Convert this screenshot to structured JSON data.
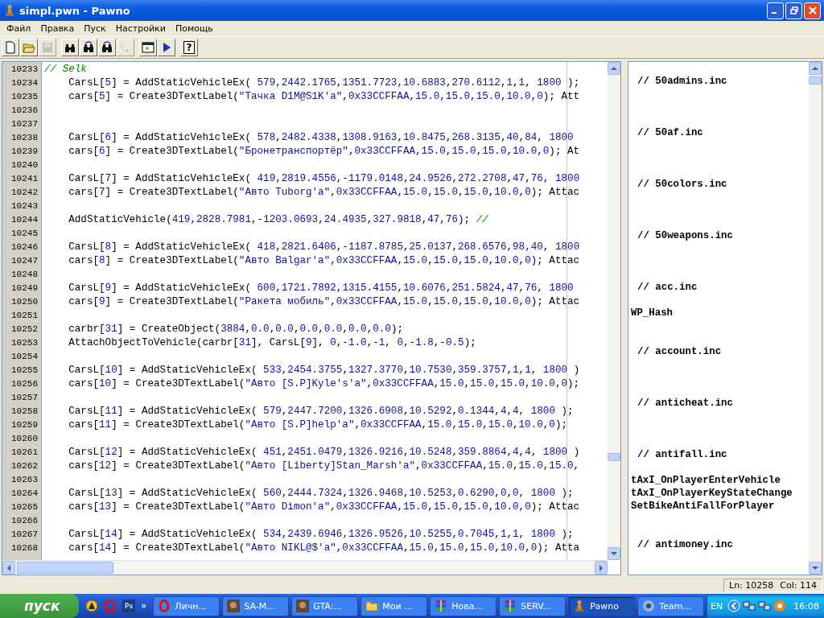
{
  "window": {
    "title": "simpl.pwn - Pawno"
  },
  "menu": [
    {
      "label": "Файл"
    },
    {
      "label": "Правка"
    },
    {
      "label": "Пуск"
    },
    {
      "label": "Настройки"
    },
    {
      "label": "Помощь"
    }
  ],
  "toolbar": {
    "groups": [
      {
        "buttons": [
          {
            "kind": "new",
            "disabled": false
          },
          {
            "kind": "open",
            "disabled": false
          },
          {
            "kind": "save",
            "disabled": true
          }
        ]
      },
      {
        "buttons": [
          {
            "kind": "find",
            "disabled": false
          },
          {
            "kind": "find-next",
            "disabled": false
          },
          {
            "kind": "find-prev",
            "disabled": false
          },
          {
            "kind": "goto",
            "disabled": true
          }
        ]
      },
      {
        "buttons": [
          {
            "kind": "compile",
            "disabled": false
          },
          {
            "kind": "run",
            "disabled": false
          }
        ]
      },
      {
        "buttons": [
          {
            "kind": "help",
            "label": "?",
            "disabled": false
          }
        ]
      }
    ]
  },
  "editor": {
    "lines": [
      {
        "number": "10233",
        "text": "// Selk"
      },
      {
        "number": "10234",
        "text": "    CarsL[5] = AddStaticVehicleEx( 579,2442.1765,1351.7723,10.6883,270.6112,1,1, 1800 );"
      },
      {
        "number": "10235",
        "text": "    cars[5] = Create3DTextLabel(\"Тачка D1M@S1K'a\",0x33CCFFAA,15.0,15.0,15.0,10.0,0); Att"
      },
      {
        "number": "10236"
      },
      {
        "number": "10237"
      },
      {
        "number": "10238",
        "text": "    CarsL[6] = AddStaticVehicleEx( 578,2482.4338,1308.9163,10.8475,268.3135,40,84, 1800"
      },
      {
        "number": "10239",
        "text": "    cars[6] = Create3DTextLabel(\"Бронетранспортёр\",0x33CCFFAA,15.0,15.0,15.0,10.0,0); At"
      },
      {
        "number": "10240"
      },
      {
        "number": "10241",
        "text": "    CarsL[7] = AddStaticVehicleEx( 419,2819.4556,-1179.0148,24.9526,272.2708,47,76, 1800"
      },
      {
        "number": "10242",
        "text": "    cars[7] = Create3DTextLabel(\"Авто Tuborg'a\",0x33CCFFAA,15.0,15.0,15.0,10.0,0); Attac"
      },
      {
        "number": "10243"
      },
      {
        "number": "10244",
        "text": "    AddStaticVehicle(419,2828.7981,-1203.0693,24.4935,327.9818,47,76); //"
      },
      {
        "number": "10245"
      },
      {
        "number": "10246",
        "text": "    CarsL[8] = AddStaticVehicleEx( 418,2821.6406,-1187.8785,25.0137,268.6576,98,40, 1800"
      },
      {
        "number": "10247",
        "text": "    cars[8] = Create3DTextLabel(\"Авто Balgar'a\",0x33CCFFAA,15.0,15.0,15.0,10.0,0); Attac"
      },
      {
        "number": "10248"
      },
      {
        "number": "10249",
        "text": "    CarsL[9] = AddStaticVehicleEx( 600,1721.7892,1315.4155,10.6076,251.5824,47,76, 1800"
      },
      {
        "number": "10250",
        "text": "    cars[9] = Create3DTextLabel(\"Ракета мобиль\",0x33CCFFAA,15.0,15.0,15.0,10.0,0); Attac"
      },
      {
        "number": "10251"
      },
      {
        "number": "10252",
        "text": "    carbr[31] = CreateObject(3884,0.0,0.0,0.0,0.0,0.0,0.0);"
      },
      {
        "number": "10253",
        "text": "    AttachObjectToVehicle(carbr[31], CarsL[9], 0,-1.0,-1, 0,-1.8,-0.5);"
      },
      {
        "number": "10254"
      },
      {
        "number": "10255",
        "text": "    CarsL[10] = AddStaticVehicleEx( 533,2454.3755,1327.3770,10.7530,359.3757,1,1, 1800 )"
      },
      {
        "number": "10256",
        "text": "    cars[10] = Create3DTextLabel(\"Авто [S.P]Kyle's'a\",0x33CCFFAA,15.0,15.0,15.0,10.0,0);"
      },
      {
        "number": "10257"
      },
      {
        "number": "10258",
        "text": "    CarsL[11] = AddStaticVehicleEx( 579,2447.7200,1326.6908,10.5292,0.1344,4,4, 1800 );"
      },
      {
        "number": "10259",
        "text": "    cars[11] = Create3DTextLabel(\"Авто [S.P]help'a\",0x33CCFFAA,15.0,15.0,15.0,10.0,0);"
      },
      {
        "number": "10260"
      },
      {
        "number": "10261",
        "text": "    CarsL[12] = AddStaticVehicleEx( 451,2451.0479,1326.9216,10.5248,359.8864,4,4, 1800 )"
      },
      {
        "number": "10262",
        "text": "    cars[12] = Create3DTextLabel(\"Авто [Liberty]Stan_Marsh'a\",0x33CCFFAA,15.0,15.0,15.0,"
      },
      {
        "number": "10263"
      },
      {
        "number": "10264",
        "text": "    CarsL[13] = AddStaticVehicleEx( 560,2444.7324,1326.9468,10.5253,0.6290,0,0, 1800 );"
      },
      {
        "number": "10265",
        "text": "    cars[13] = Create3DTextLabel(\"Авто Dimon'a\",0x33CCFFAA,15.0,15.0,15.0,10.0,0); Attac"
      },
      {
        "number": "10266"
      },
      {
        "number": "10267",
        "text": "    CarsL[14] = AddStaticVehicleEx( 534,2439.6946,1326.9526,10.5255,0.7045,1,1, 1800 );"
      },
      {
        "number": "10268",
        "text": "    cars[14] = Create3DTextLabel(\"Авто NIKL@$'a\",0x33CCFFAA,15.0,15.0,15.0,10.0,0); Atta"
      }
    ]
  },
  "function_list": [
    {
      "include": "// 50admins.inc"
    },
    {
      "include": "// 50af.inc"
    },
    {
      "include": "// 50colors.inc"
    },
    {
      "include": "// 50weapons.inc"
    },
    {
      "include": "// acc.inc",
      "functions": [
        "WP_Hash"
      ]
    },
    {
      "include": "// account.inc"
    },
    {
      "include": "// anticheat.inc"
    },
    {
      "include": "// antifall.inc",
      "functions": [
        "tAxI_OnPlayerEnterVehicle",
        "tAxI_OnPlayerKeyStateChange",
        "SetBikeAntiFallForPlayer"
      ]
    },
    {
      "include": "// antimoney.inc"
    }
  ],
  "status_bar": {
    "line": "Ln: 10258",
    "column": "Col: 114"
  },
  "taskbar": {
    "start": "пуск",
    "quick_launch": [
      {
        "kind": "aim"
      },
      {
        "kind": "opera"
      },
      {
        "kind": "photoshop",
        "label": "Ps"
      }
    ],
    "overflow": "»",
    "tasks": [
      {
        "label": "Личн...",
        "kind": "opera",
        "selected": false
      },
      {
        "label": "SA-M...",
        "kind": "picture",
        "selected": false
      },
      {
        "label": "GTA:...",
        "kind": "picture",
        "selected": false
      },
      {
        "label": "Мои ...",
        "kind": "folder",
        "selected": false
      },
      {
        "label": "Нова...",
        "kind": "archive",
        "selected": false
      },
      {
        "label": "SERV...",
        "kind": "archive",
        "selected": false
      },
      {
        "label": "Pawno",
        "kind": "pawno",
        "selected": true
      },
      {
        "label": "Team...",
        "kind": "teamspeak",
        "selected": false
      }
    ],
    "language": "EN",
    "clock": "16:08"
  }
}
